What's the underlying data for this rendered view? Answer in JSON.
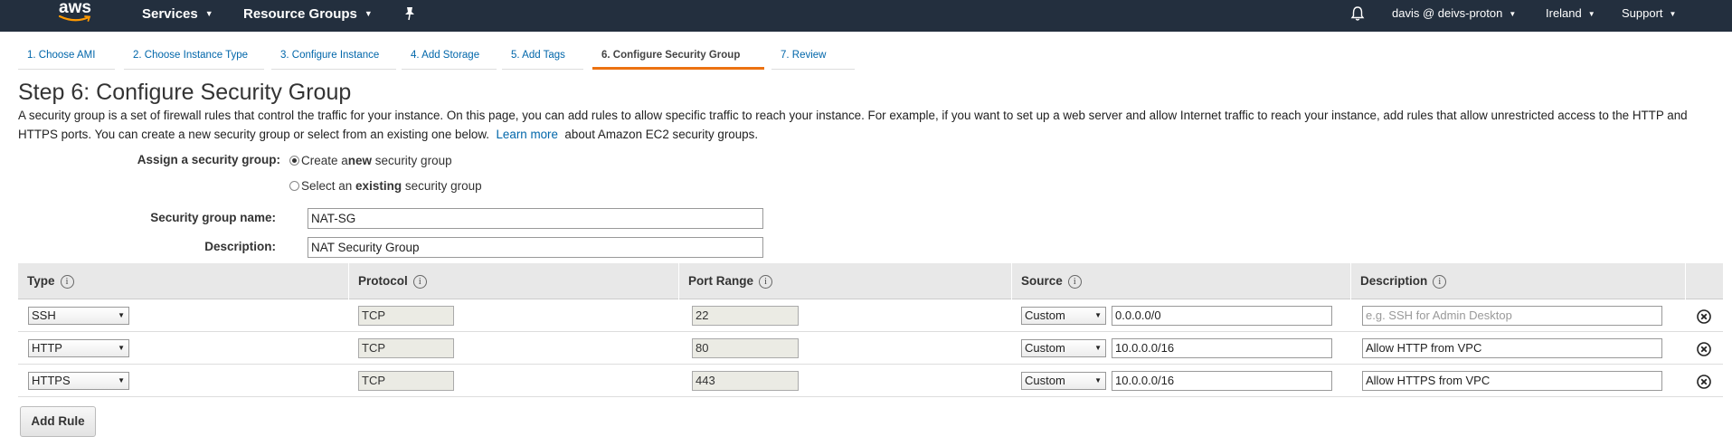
{
  "nav": {
    "logo_text": "aws",
    "services": "Services",
    "resource_groups": "Resource Groups",
    "account": "davis @ deivs-proton",
    "region": "Ireland",
    "support": "Support",
    "bg_color": "#232f3e"
  },
  "tabs": [
    {
      "label": "1. Choose AMI",
      "active": false
    },
    {
      "label": "2. Choose Instance Type",
      "active": false
    },
    {
      "label": "3. Configure Instance",
      "active": false
    },
    {
      "label": "4. Add Storage",
      "active": false
    },
    {
      "label": "5. Add Tags",
      "active": false
    },
    {
      "label": "6. Configure Security Group",
      "active": true
    },
    {
      "label": "7. Review",
      "active": false
    }
  ],
  "page": {
    "title": "Step 6: Configure Security Group",
    "intro_1": "A security group is a set of firewall rules that control the traffic for your instance. On this page, you can add rules to allow specific traffic to reach your instance. For example, if you want to set up a web server and allow Internet traffic to reach your instance, add rules that allow unrestricted access to the HTTP and HTTPS ports. You can create a new security group or select from an existing one below.",
    "learn_more": "Learn more",
    "intro_2": "about Amazon EC2 security groups."
  },
  "form": {
    "assign_label": "Assign a security group:",
    "radio_new_pre": "Create a ",
    "radio_new_bold": "new",
    "radio_new_post": " security group",
    "radio_existing_pre": "Select an ",
    "radio_existing_bold": "existing",
    "radio_existing_post": " security group",
    "selected": "new",
    "name_label": "Security group name:",
    "name_value": "NAT-SG",
    "desc_label": "Description:",
    "desc_value": "NAT Security Group"
  },
  "rules": {
    "headers": {
      "type": "Type",
      "protocol": "Protocol",
      "port_range": "Port Range",
      "source": "Source",
      "description": "Description"
    },
    "rows": [
      {
        "type": "SSH",
        "protocol": "TCP",
        "port": "22",
        "source_mode": "Custom",
        "source": "0.0.0.0/0",
        "description": "",
        "description_placeholder": "e.g. SSH for Admin Desktop"
      },
      {
        "type": "HTTP",
        "protocol": "TCP",
        "port": "80",
        "source_mode": "Custom",
        "source": "10.0.0.0/16",
        "description": "Allow HTTP from VPC",
        "description_placeholder": ""
      },
      {
        "type": "HTTPS",
        "protocol": "TCP",
        "port": "443",
        "source_mode": "Custom",
        "source": "10.0.0.0/16",
        "description": "Allow HTTPS from VPC",
        "description_placeholder": ""
      }
    ],
    "add_rule": "Add Rule"
  },
  "icons": {
    "pin": "pin-icon",
    "bell": "bell-icon",
    "info": "info-icon",
    "remove": "remove-circle-icon",
    "caret": "caret-down-icon"
  },
  "colors": {
    "link": "#0066aa",
    "active_tab_underline": "#ec7211",
    "table_header_bg": "#e8e8e8"
  }
}
